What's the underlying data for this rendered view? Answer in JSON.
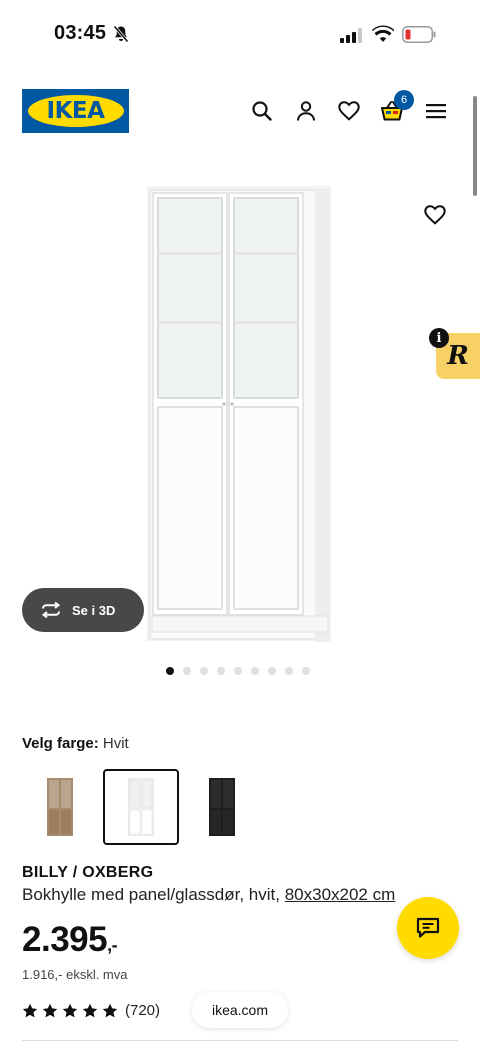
{
  "status_bar": {
    "time": "03:45"
  },
  "header": {
    "logo_text": "IKEA",
    "basket_count": "6"
  },
  "product_image": {
    "see_3d_label": "Se i 3D",
    "image_count": 9,
    "active_index": 0
  },
  "color_chooser": {
    "label": "Velg farge:",
    "selected": "Hvit",
    "swatches": [
      "brown-oak",
      "white",
      "black"
    ]
  },
  "product": {
    "name": "BILLY / OXBERG",
    "description": "Bokhylle med panel/glassdør, hvit,",
    "dimensions": "80x30x202 cm",
    "price": "2.395",
    "price_suffix": ",-",
    "price_ex_vat": "1.916,- ekskl. mva",
    "rating": 5,
    "review_count": "(720)"
  },
  "browser": {
    "url": "ikea.com"
  },
  "colors": {
    "ikea_blue": "#0058a3",
    "ikea_yellow": "#ffdb00",
    "pill_dark": "#484848"
  }
}
